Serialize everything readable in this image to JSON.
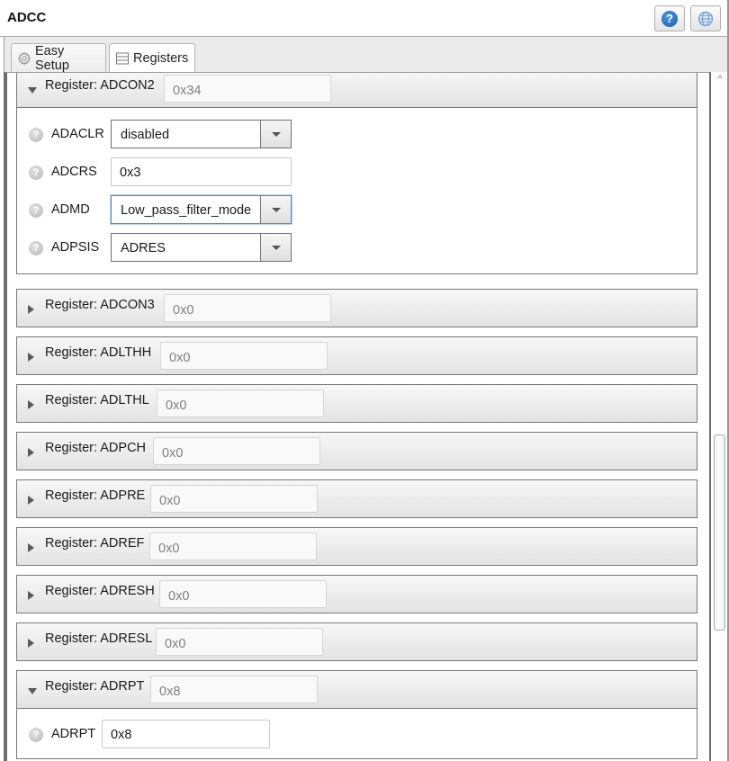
{
  "window": {
    "title": "ADCC",
    "help_button": "help-icon",
    "globe_button": "globe-icon"
  },
  "tabs": [
    {
      "label": "Easy Setup",
      "icon": "gear-icon",
      "active": false
    },
    {
      "label": "Registers",
      "icon": "register-list-icon",
      "active": true
    }
  ],
  "registers": [
    {
      "label": "Register: ADCON2",
      "value": "0x34",
      "expanded": true,
      "fields": [
        {
          "name": "ADACLR",
          "type": "combo",
          "value": "disabled"
        },
        {
          "name": "ADCRS",
          "type": "text",
          "value": "0x3"
        },
        {
          "name": "ADMD",
          "type": "combo",
          "value": "Low_pass_filter_mode",
          "focused": true
        },
        {
          "name": "ADPSIS",
          "type": "combo",
          "value": "ADRES"
        }
      ]
    },
    {
      "label": "Register: ADCON3",
      "value": "0x0",
      "expanded": false
    },
    {
      "label": "Register: ADLTHH",
      "value": "0x0",
      "expanded": false
    },
    {
      "label": "Register: ADLTHL",
      "value": "0x0",
      "expanded": false
    },
    {
      "label": "Register: ADPCH",
      "value": "0x0",
      "expanded": false
    },
    {
      "label": "Register: ADPRE",
      "value": "0x0",
      "expanded": false
    },
    {
      "label": "Register: ADREF",
      "value": "0x0",
      "expanded": false
    },
    {
      "label": "Register: ADRESH",
      "value": "0x0",
      "expanded": false
    },
    {
      "label": "Register: ADRESL",
      "value": "0x0",
      "expanded": false
    },
    {
      "label": "Register: ADRPT",
      "value": "0x8",
      "expanded": true,
      "fields": [
        {
          "name": "ADRPT",
          "type": "text",
          "value": "0x8"
        }
      ]
    }
  ],
  "help_glyph": "?"
}
